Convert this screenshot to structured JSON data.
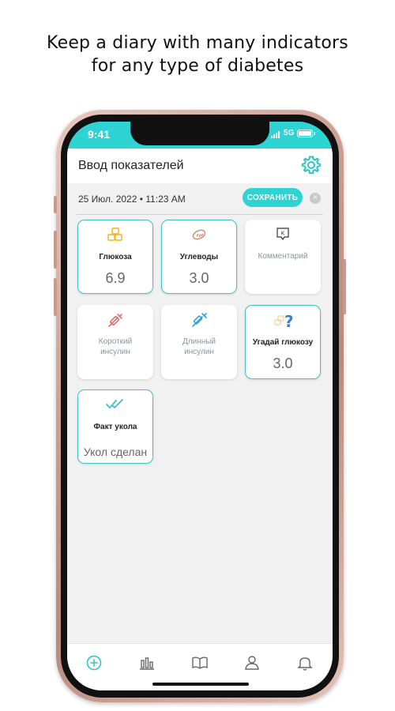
{
  "promo": {
    "line1": "Keep a diary with many indicators",
    "line2": "for any type of diabetes"
  },
  "status_bar": {
    "time": "9:41",
    "network": "5G"
  },
  "header": {
    "title": "Ввод показателей",
    "settings_icon": "gear-icon"
  },
  "entry": {
    "datetime": "25 Июл. 2022 • 11:23 AM",
    "save_label": "СОХРАНИТЬ",
    "close_symbol": "×"
  },
  "cards": [
    {
      "label": "Глюкоза",
      "value": "6.9",
      "icon": "sugar-cubes-icon",
      "active": true
    },
    {
      "label": "Углеводы",
      "value": "3.0",
      "icon": "bread-icon",
      "active": true
    },
    {
      "label": "Комментарий",
      "value": "",
      "icon": "comment-icon",
      "icon_text": "K",
      "active": false
    },
    {
      "label_line1": "Короткий",
      "label_line2": "инсулин",
      "value": "",
      "icon": "syringe-short-icon",
      "active": false
    },
    {
      "label_line1": "Длинный",
      "label_line2": "инсулин",
      "value": "",
      "icon": "syringe-long-icon",
      "active": false
    },
    {
      "label": "Угадай глюкозу",
      "value": "3.0",
      "icon": "guess-question-icon",
      "icon_text": "?",
      "active": true
    },
    {
      "label": "Факт укола",
      "value": "Укол сделан",
      "icon": "double-check-icon",
      "active": true
    }
  ],
  "colors": {
    "accent": "#2ed3d3",
    "card_border": "#3fc3c6",
    "glucose_icon": "#f2b01e",
    "bread_icon": "#d9876a",
    "short_insulin_icon": "#e56d6d",
    "long_insulin_icon": "#3a9fd6"
  },
  "bottom_nav": [
    {
      "name": "add-icon"
    },
    {
      "name": "stats-icon"
    },
    {
      "name": "book-icon"
    },
    {
      "name": "profile-icon"
    },
    {
      "name": "bell-icon"
    }
  ]
}
